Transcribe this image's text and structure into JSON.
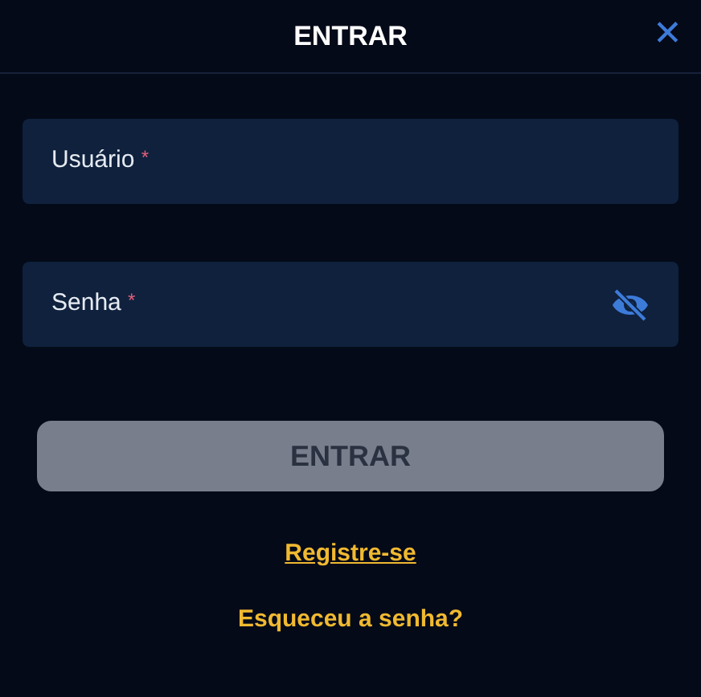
{
  "dialog": {
    "title": "ENTRAR",
    "close": "✕"
  },
  "fields": [
    {
      "kind": "text",
      "placeholder": "Usuário",
      "required_mark": "*"
    },
    {
      "kind": "password",
      "placeholder": "Senha",
      "required_mark": "*",
      "password_visible": false
    }
  ],
  "submit": {
    "label": "ENTRAR",
    "disabled": true
  },
  "links": [
    {
      "label": "Registre-se",
      "underlined": true
    },
    {
      "label": "Esqueceu a senha?",
      "underlined": false
    }
  ]
}
